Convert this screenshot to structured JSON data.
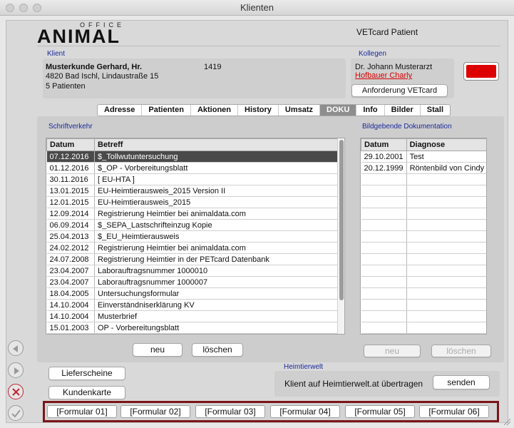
{
  "window": {
    "title": "Klienten"
  },
  "logo": {
    "office": "OFFICE",
    "animal": "ANIMAL"
  },
  "header": {
    "title": "VETcard Patient"
  },
  "client": {
    "label": "Klient",
    "name": "Musterkunde Gerhard, Hr.",
    "number": "1419",
    "address": "4820 Bad Ischl, Lindaustraße 15",
    "patients": "5 Patienten"
  },
  "colleague": {
    "label": "Kollegen",
    "name": "Dr. Johann Musterarzt",
    "link": "Hofbauer Charly",
    "request_button": "Anforderung VETcard"
  },
  "status_color": "#dd0000",
  "tabs": [
    {
      "label": "Adresse"
    },
    {
      "label": "Patienten"
    },
    {
      "label": "Aktionen"
    },
    {
      "label": "History"
    },
    {
      "label": "Umsatz"
    },
    {
      "label": "DOKU",
      "active": true
    },
    {
      "label": "Info"
    },
    {
      "label": "Bilder"
    },
    {
      "label": "Stall"
    }
  ],
  "correspondence": {
    "label": "Schriftverkehr",
    "columns": [
      "Datum",
      "Betreff"
    ],
    "rows": [
      {
        "date": "07.12.2016",
        "subject": "$_Tollwutuntersuchung",
        "selected": true
      },
      {
        "date": "01.12.2016",
        "subject": "$_OP - Vorbereitungsblatt"
      },
      {
        "date": "30.11.2016",
        "subject": "[ EU-HTA ]"
      },
      {
        "date": "13.01.2015",
        "subject": "EU-Heimtierausweis_2015 Version II"
      },
      {
        "date": "12.01.2015",
        "subject": "EU-Heimtierausweis_2015"
      },
      {
        "date": "12.09.2014",
        "subject": "Registrierung Heimtier bei animaldata.com"
      },
      {
        "date": "06.09.2014",
        "subject": "$_SEPA_Lastschrifteinzug Kopie"
      },
      {
        "date": "25.04.2013",
        "subject": "$_EU_Heimtierausweis"
      },
      {
        "date": "24.02.2012",
        "subject": "Registrierung Heimtier bei animaldata.com"
      },
      {
        "date": "24.07.2008",
        "subject": "Registrierung Heimtier in der PETcard Datenbank"
      },
      {
        "date": "23.04.2007",
        "subject": "Laborauftragsnummer 1000010"
      },
      {
        "date": "23.04.2007",
        "subject": "Laborauftragsnummer 1000007"
      },
      {
        "date": "18.04.2005",
        "subject": "Untersuchungsformular"
      },
      {
        "date": "14.10.2004",
        "subject": "Einverständniserklärung KV"
      },
      {
        "date": "14.10.2004",
        "subject": "Musterbrief"
      },
      {
        "date": "15.01.2003",
        "subject": "OP - Vorbereitungsblatt"
      }
    ],
    "new_button": "neu",
    "delete_button": "löschen"
  },
  "imaging": {
    "label": "Bildgebende Dokumentation",
    "columns": [
      "Datum",
      "Diagnose"
    ],
    "rows": [
      {
        "date": "29.10.2001",
        "diagnosis": "Test"
      },
      {
        "date": "20.12.1999",
        "diagnosis": "Röntenbild von Cindy"
      }
    ],
    "new_button": "neu",
    "delete_button": "löschen"
  },
  "buttons": {
    "delivery_notes": "Lieferscheine",
    "customer_card": "Kundenkarte"
  },
  "heimtierwelt": {
    "label": "Heimtierwelt",
    "text": "Klient auf Heimtierwelt.at übertragen",
    "send_button": "senden"
  },
  "forms": [
    "[Formular 01]",
    "[Formular 02]",
    "[Formular 03]",
    "[Formular 04]",
    "[Formular 05]",
    "[Formular 06]"
  ]
}
